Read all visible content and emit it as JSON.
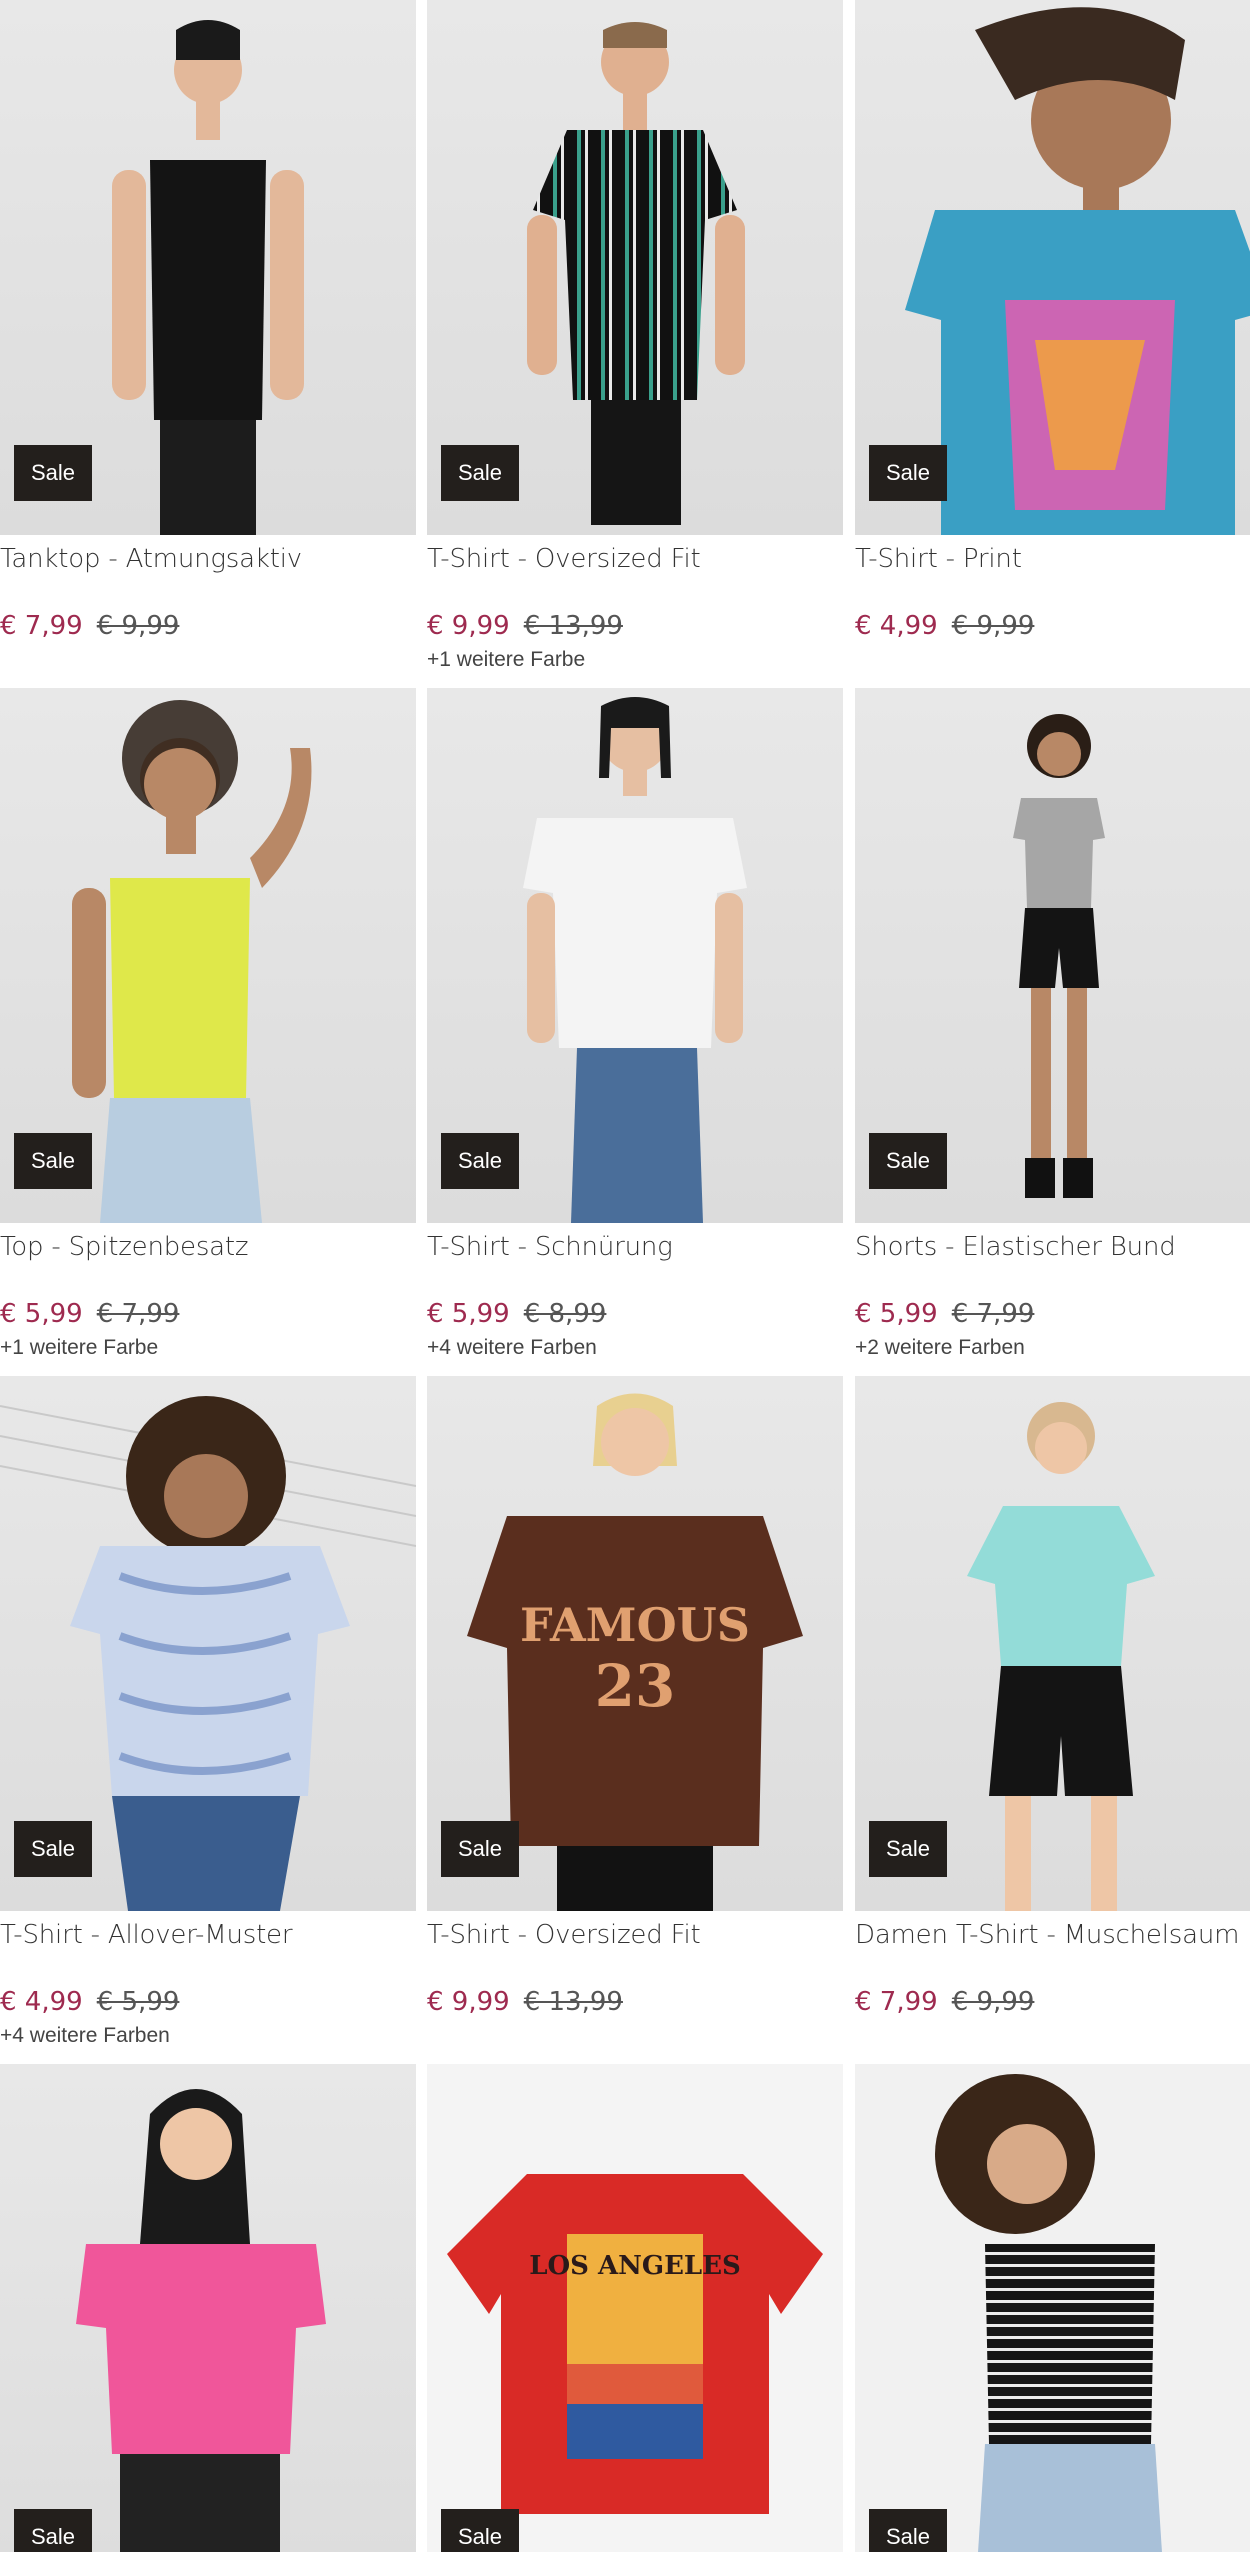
{
  "colors": {
    "price_accent": "#9e2a4f",
    "badge_bg": "#231f1c"
  },
  "products": [
    {
      "title": "Tanktop - Atmungsaktiv",
      "badge": "Sale",
      "price": "€ 7,99",
      "old_price": "€ 9,99",
      "colors_note": "",
      "garment_color": "#141414",
      "icon": "tank-top-icon"
    },
    {
      "title": "T-Shirt - Oversized Fit",
      "badge": "Sale",
      "price": "€ 9,99",
      "old_price": "€ 13,99",
      "colors_note": "+1 weitere Farbe",
      "garment_color": "#1f4a44",
      "icon": "tshirt-icon"
    },
    {
      "title": "T-Shirt - Print",
      "badge": "Sale",
      "price": "€ 4,99",
      "old_price": "€ 9,99",
      "colors_note": "",
      "garment_color": "#3a9fc4",
      "icon": "tshirt-icon"
    },
    {
      "title": "Top - Spitzenbesatz",
      "badge": "Sale",
      "price": "€ 5,99",
      "old_price": "€ 7,99",
      "colors_note": "+1 weitere Farbe",
      "garment_color": "#dfe84a",
      "icon": "tank-top-icon"
    },
    {
      "title": "T-Shirt - Schnürung",
      "badge": "Sale",
      "price": "€ 5,99",
      "old_price": "€ 8,99",
      "colors_note": "+4 weitere Farben",
      "garment_color": "#f4f4f4",
      "icon": "tshirt-icon"
    },
    {
      "title": "Shorts - Elastischer Bund",
      "badge": "Sale",
      "price": "€ 5,99",
      "old_price": "€ 7,99",
      "colors_note": "+2 weitere Farben",
      "garment_color": "#141414",
      "icon": "shorts-icon"
    },
    {
      "title": "T-Shirt - Allover-Muster",
      "badge": "Sale",
      "price": "€ 4,99",
      "old_price": "€ 5,99",
      "colors_note": "+4 weitere Farben",
      "garment_color": "#c9d6ec",
      "icon": "tshirt-icon"
    },
    {
      "title": "T-Shirt - Oversized Fit",
      "badge": "Sale",
      "price": "€ 9,99",
      "old_price": "€ 13,99",
      "colors_note": "",
      "garment_color": "#5a2e1e",
      "icon": "tshirt-icon"
    },
    {
      "title": "Damen T-Shirt - Muschelsaum",
      "badge": "Sale",
      "price": "€ 7,99",
      "old_price": "€ 9,99",
      "colors_note": "",
      "garment_color": "#93dcd8",
      "icon": "tshirt-icon"
    },
    {
      "title": "",
      "badge": "Sale",
      "price": "",
      "old_price": "",
      "colors_note": "",
      "garment_color": "#f0569a",
      "icon": "tshirt-icon"
    },
    {
      "title": "",
      "badge": "Sale",
      "price": "",
      "old_price": "",
      "colors_note": "",
      "garment_color": "#d92a26",
      "icon": "tshirt-icon"
    },
    {
      "title": "",
      "badge": "Sale",
      "price": "",
      "old_price": "",
      "colors_note": "",
      "garment_color": "#1a1a1a",
      "icon": "tank-top-icon"
    }
  ]
}
